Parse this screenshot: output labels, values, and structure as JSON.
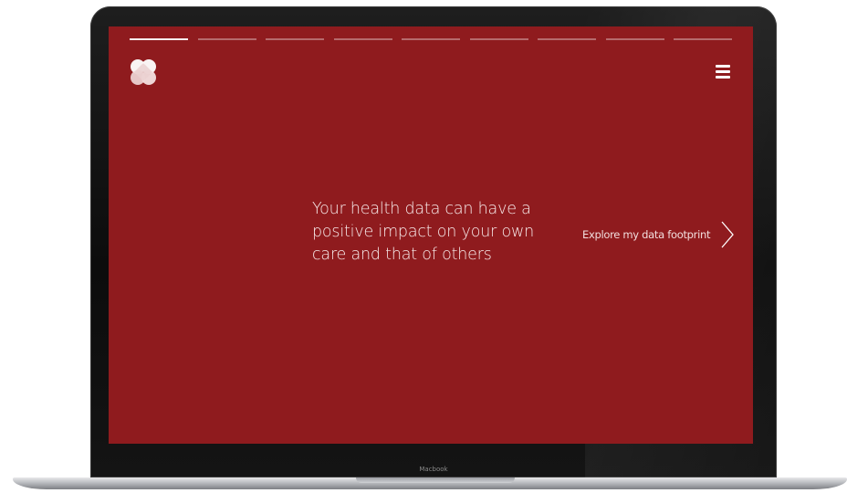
{
  "device": {
    "label": "Macbook"
  },
  "progress": {
    "total_steps": 9,
    "active_step": 1
  },
  "header": {
    "logo_icon": "heart-clover-logo-icon",
    "menu_icon": "hamburger-menu-icon"
  },
  "main": {
    "headline": "Your health data can have a positive impact on your own care and that of others",
    "cta_label": "Explore my data footprint",
    "cta_icon": "chevron-right-icon"
  },
  "colors": {
    "background": "#8f1b1e",
    "text": "#ffffff"
  }
}
